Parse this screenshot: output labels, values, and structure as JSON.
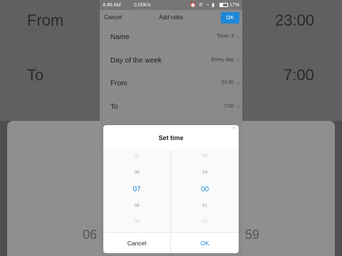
{
  "background": {
    "left_from": "From",
    "right_from_value": "23:00",
    "left_to": "To",
    "right_to_value": "7:00",
    "left_bottom": "06",
    "right_bottom": "59"
  },
  "statusbar": {
    "time": "4:46 AM",
    "speed": "0.00K/s",
    "battery": "17%"
  },
  "appbar": {
    "cancel": "Cancel",
    "title": "Add rules",
    "ok": "OK"
  },
  "rows": [
    {
      "label": "Name",
      "value": "Timer 3"
    },
    {
      "label": "Day of the week",
      "value": "Every day"
    },
    {
      "label": "From",
      "value": "23:00"
    },
    {
      "label": "To",
      "value": "7:00"
    }
  ],
  "dialog": {
    "title": "Set time",
    "hours": {
      "above2": "05",
      "above1": "06",
      "selected": "07",
      "below1": "08",
      "below2": "09"
    },
    "minutes": {
      "above2": "58",
      "above1": "59",
      "selected": "00",
      "below1": "01",
      "below2": "02"
    },
    "cancel": "Cancel",
    "ok": "OK"
  },
  "colors": {
    "accent": "#1e88d8"
  }
}
